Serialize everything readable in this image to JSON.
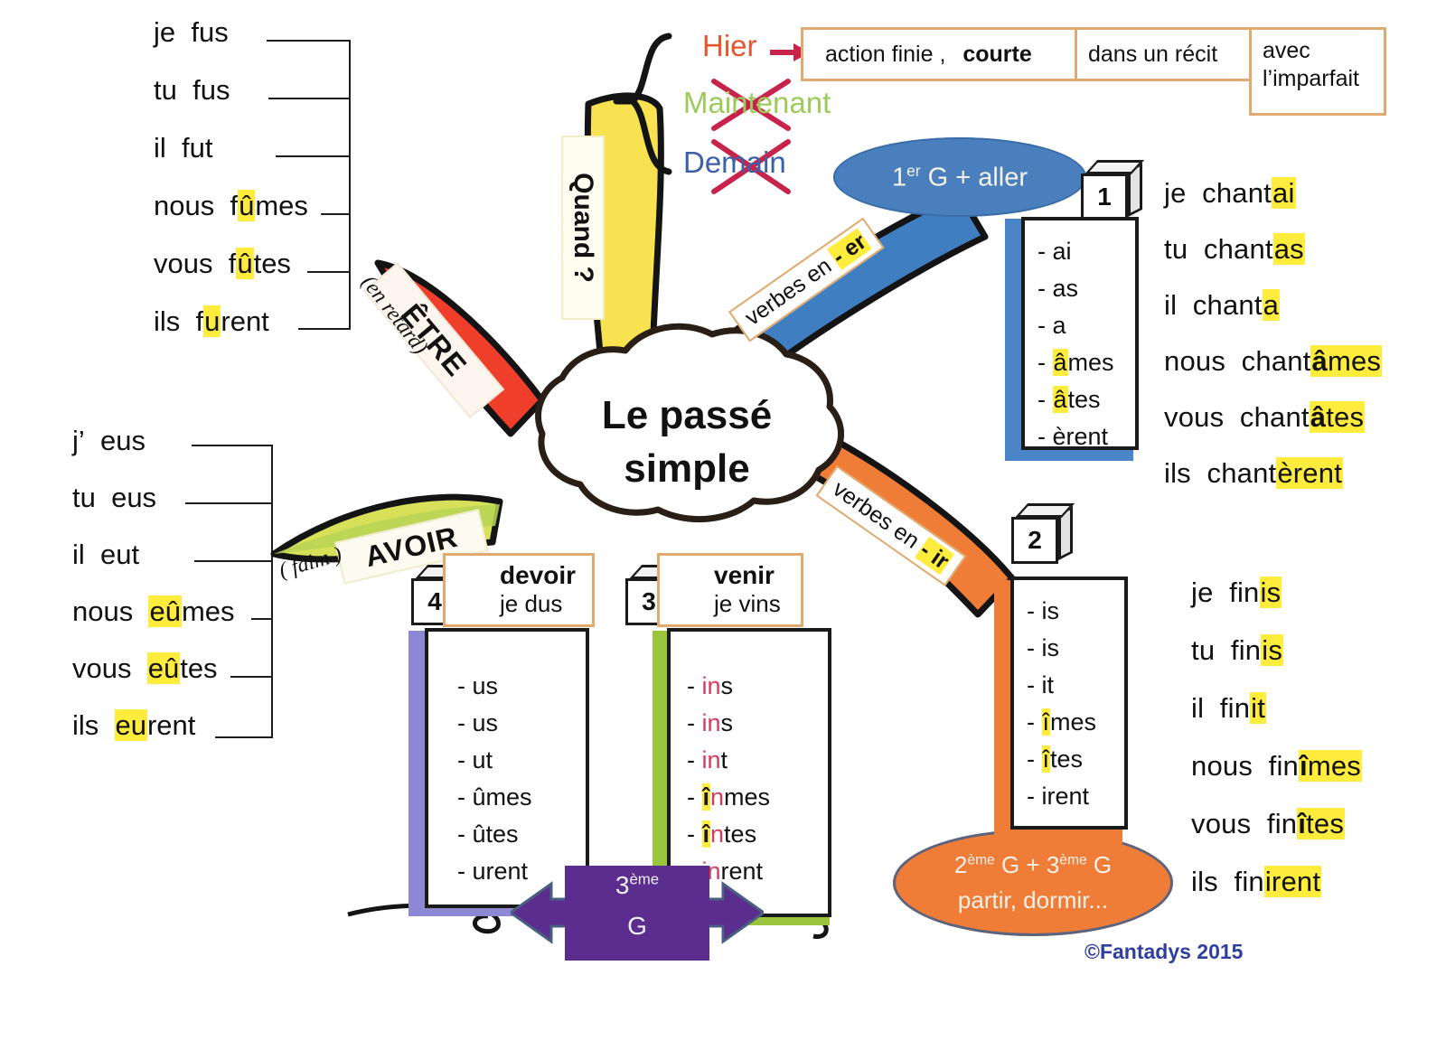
{
  "title": "Le passé simple",
  "copyright": "©Fantadys 2015",
  "center": {
    "line1": "Le passé",
    "line2": "simple"
  },
  "time_branch": {
    "label": "Quand ?",
    "words": [
      {
        "text": "Hier",
        "color": "#e8542b",
        "struck": false
      },
      {
        "text": "Maintenant",
        "color": "#9ccb5a",
        "struck": true
      },
      {
        "text": "Demain",
        "color": "#3c5fa8",
        "struck": true
      }
    ],
    "boxes": [
      {
        "text_plain": "action finie , ",
        "text_bold": "courte"
      },
      {
        "text_plain": "dans un récit",
        "text_bold": ""
      }
    ],
    "box_tall": {
      "line1": "avec",
      "line2": "l’imparfait"
    }
  },
  "etre_branch": {
    "label": "ÊTRE",
    "note": "(en retard)",
    "color": "#ef3e2a",
    "conjugation": [
      {
        "pron": "je",
        "stem": "f",
        "hi": "",
        "tail": "us"
      },
      {
        "pron": "tu",
        "stem": "f",
        "hi": "",
        "tail": "us"
      },
      {
        "pron": "il",
        "stem": "f",
        "hi": "",
        "tail": "ut"
      },
      {
        "pron": "nous",
        "stem": "f",
        "hi": "û",
        "tail": "mes"
      },
      {
        "pron": "vous",
        "stem": "f",
        "hi": "û",
        "tail": "tes"
      },
      {
        "pron": "ils",
        "stem": "f",
        "hi": "u",
        "tail": "rent"
      }
    ]
  },
  "avoir_branch": {
    "label": "AVOIR",
    "note": "( faim )",
    "color": "#c7d94a",
    "conjugation": [
      {
        "pron": "j’",
        "stem": "",
        "hi": "",
        "tail": "eus"
      },
      {
        "pron": "tu",
        "stem": "",
        "hi": "",
        "tail": "eus"
      },
      {
        "pron": "il",
        "stem": "",
        "hi": "",
        "tail": "eut"
      },
      {
        "pron": "nous",
        "stem": "",
        "hi": "eû",
        "tail": "mes"
      },
      {
        "pron": "vous",
        "stem": "",
        "hi": "eû",
        "tail": "tes"
      },
      {
        "pron": "ils",
        "stem": "",
        "hi": "eu",
        "tail": "rent"
      }
    ]
  },
  "er_branch": {
    "banner_plain": "verbes en ",
    "banner_hl": "- er",
    "color": "#3f7fc1",
    "bubble": {
      "pre": "1",
      "sup": "er",
      "post": " G + aller"
    },
    "group_number": "1",
    "endings": [
      {
        "pre": "- ",
        "hi": "",
        "rest": "ai"
      },
      {
        "pre": "- ",
        "hi": "",
        "rest": "as"
      },
      {
        "pre": "- ",
        "hi": "",
        "rest": "a"
      },
      {
        "pre": "- ",
        "hi": "â",
        "rest": "mes"
      },
      {
        "pre": "- ",
        "hi": "â",
        "rest": "tes"
      },
      {
        "pre": "- ",
        "hi": "",
        "rest": "èrent"
      }
    ],
    "conjugation": [
      {
        "pron": "je",
        "stem": "chant",
        "hi": "ai",
        "tail": ""
      },
      {
        "pron": "tu",
        "stem": "chant",
        "hi": "as",
        "tail": ""
      },
      {
        "pron": "il",
        "stem": "chant",
        "hi": "a",
        "tail": ""
      },
      {
        "pron": "nous",
        "stem": "chant",
        "hi": "âmes",
        "tail": ""
      },
      {
        "pron": "vous",
        "stem": "chant",
        "hi": "âtes",
        "tail": ""
      },
      {
        "pron": "ils",
        "stem": "chant",
        "hi": "èrent",
        "tail": ""
      }
    ]
  },
  "ir_branch": {
    "banner_plain": "verbes en ",
    "banner_hl": "- ir",
    "color": "#ef7c37",
    "bubble": {
      "l1_pre": "2",
      "l1_sup": "ème",
      "l1_mid": " G + 3",
      "l1_sup2": "ème",
      "l1_post": " G",
      "l2": "partir, dormir..."
    },
    "group_number": "2",
    "endings": [
      {
        "pre": "- ",
        "hi": "",
        "rest": "is"
      },
      {
        "pre": "- ",
        "hi": "",
        "rest": "is"
      },
      {
        "pre": "- ",
        "hi": "",
        "rest": "it"
      },
      {
        "pre": "- ",
        "hi": "î",
        "rest": "mes"
      },
      {
        "pre": "- ",
        "hi": "î",
        "rest": "tes"
      },
      {
        "pre": "- ",
        "hi": "",
        "rest": "irent"
      }
    ],
    "conjugation": [
      {
        "pron": "je",
        "stem": "fin",
        "hi": "is",
        "tail": ""
      },
      {
        "pron": "tu",
        "stem": "fin",
        "hi": "is",
        "tail": ""
      },
      {
        "pron": "il",
        "stem": "fin",
        "hi": "it",
        "tail": ""
      },
      {
        "pron": "nous",
        "stem": "fin",
        "hi": "îmes",
        "tail": ""
      },
      {
        "pron": "vous",
        "stem": "fin",
        "hi": "îtes",
        "tail": ""
      },
      {
        "pron": "ils",
        "stem": "fin",
        "hi": "irent",
        "tail": ""
      }
    ]
  },
  "devoir_card": {
    "number": "4",
    "verb": "devoir",
    "example": "je dus",
    "color": "#7b74c9",
    "endings": [
      "- us",
      "- us",
      "- ut",
      "- ûmes",
      "- ûtes",
      "- urent"
    ]
  },
  "venir_card": {
    "number": "3",
    "verb": "venir",
    "example": "je vins",
    "color": "#9ac43b",
    "endings": [
      {
        "dash": "- ",
        "red": "in",
        "hi": "",
        "rest": "s"
      },
      {
        "dash": "- ",
        "red": "in",
        "hi": "",
        "rest": "s"
      },
      {
        "dash": "- ",
        "red": "in",
        "hi": "",
        "rest": "t"
      },
      {
        "dash": "- ",
        "red": "",
        "hi": "în",
        "rest": "mes"
      },
      {
        "dash": "- ",
        "red": "",
        "hi": "în",
        "rest": "tes"
      },
      {
        "dash": "- ",
        "red": "in",
        "hi": "",
        "rest": "rent"
      }
    ]
  },
  "group3_arrow": {
    "pre": "3",
    "sup": "ème",
    "line2": "G",
    "color": "#5b2d8e"
  }
}
